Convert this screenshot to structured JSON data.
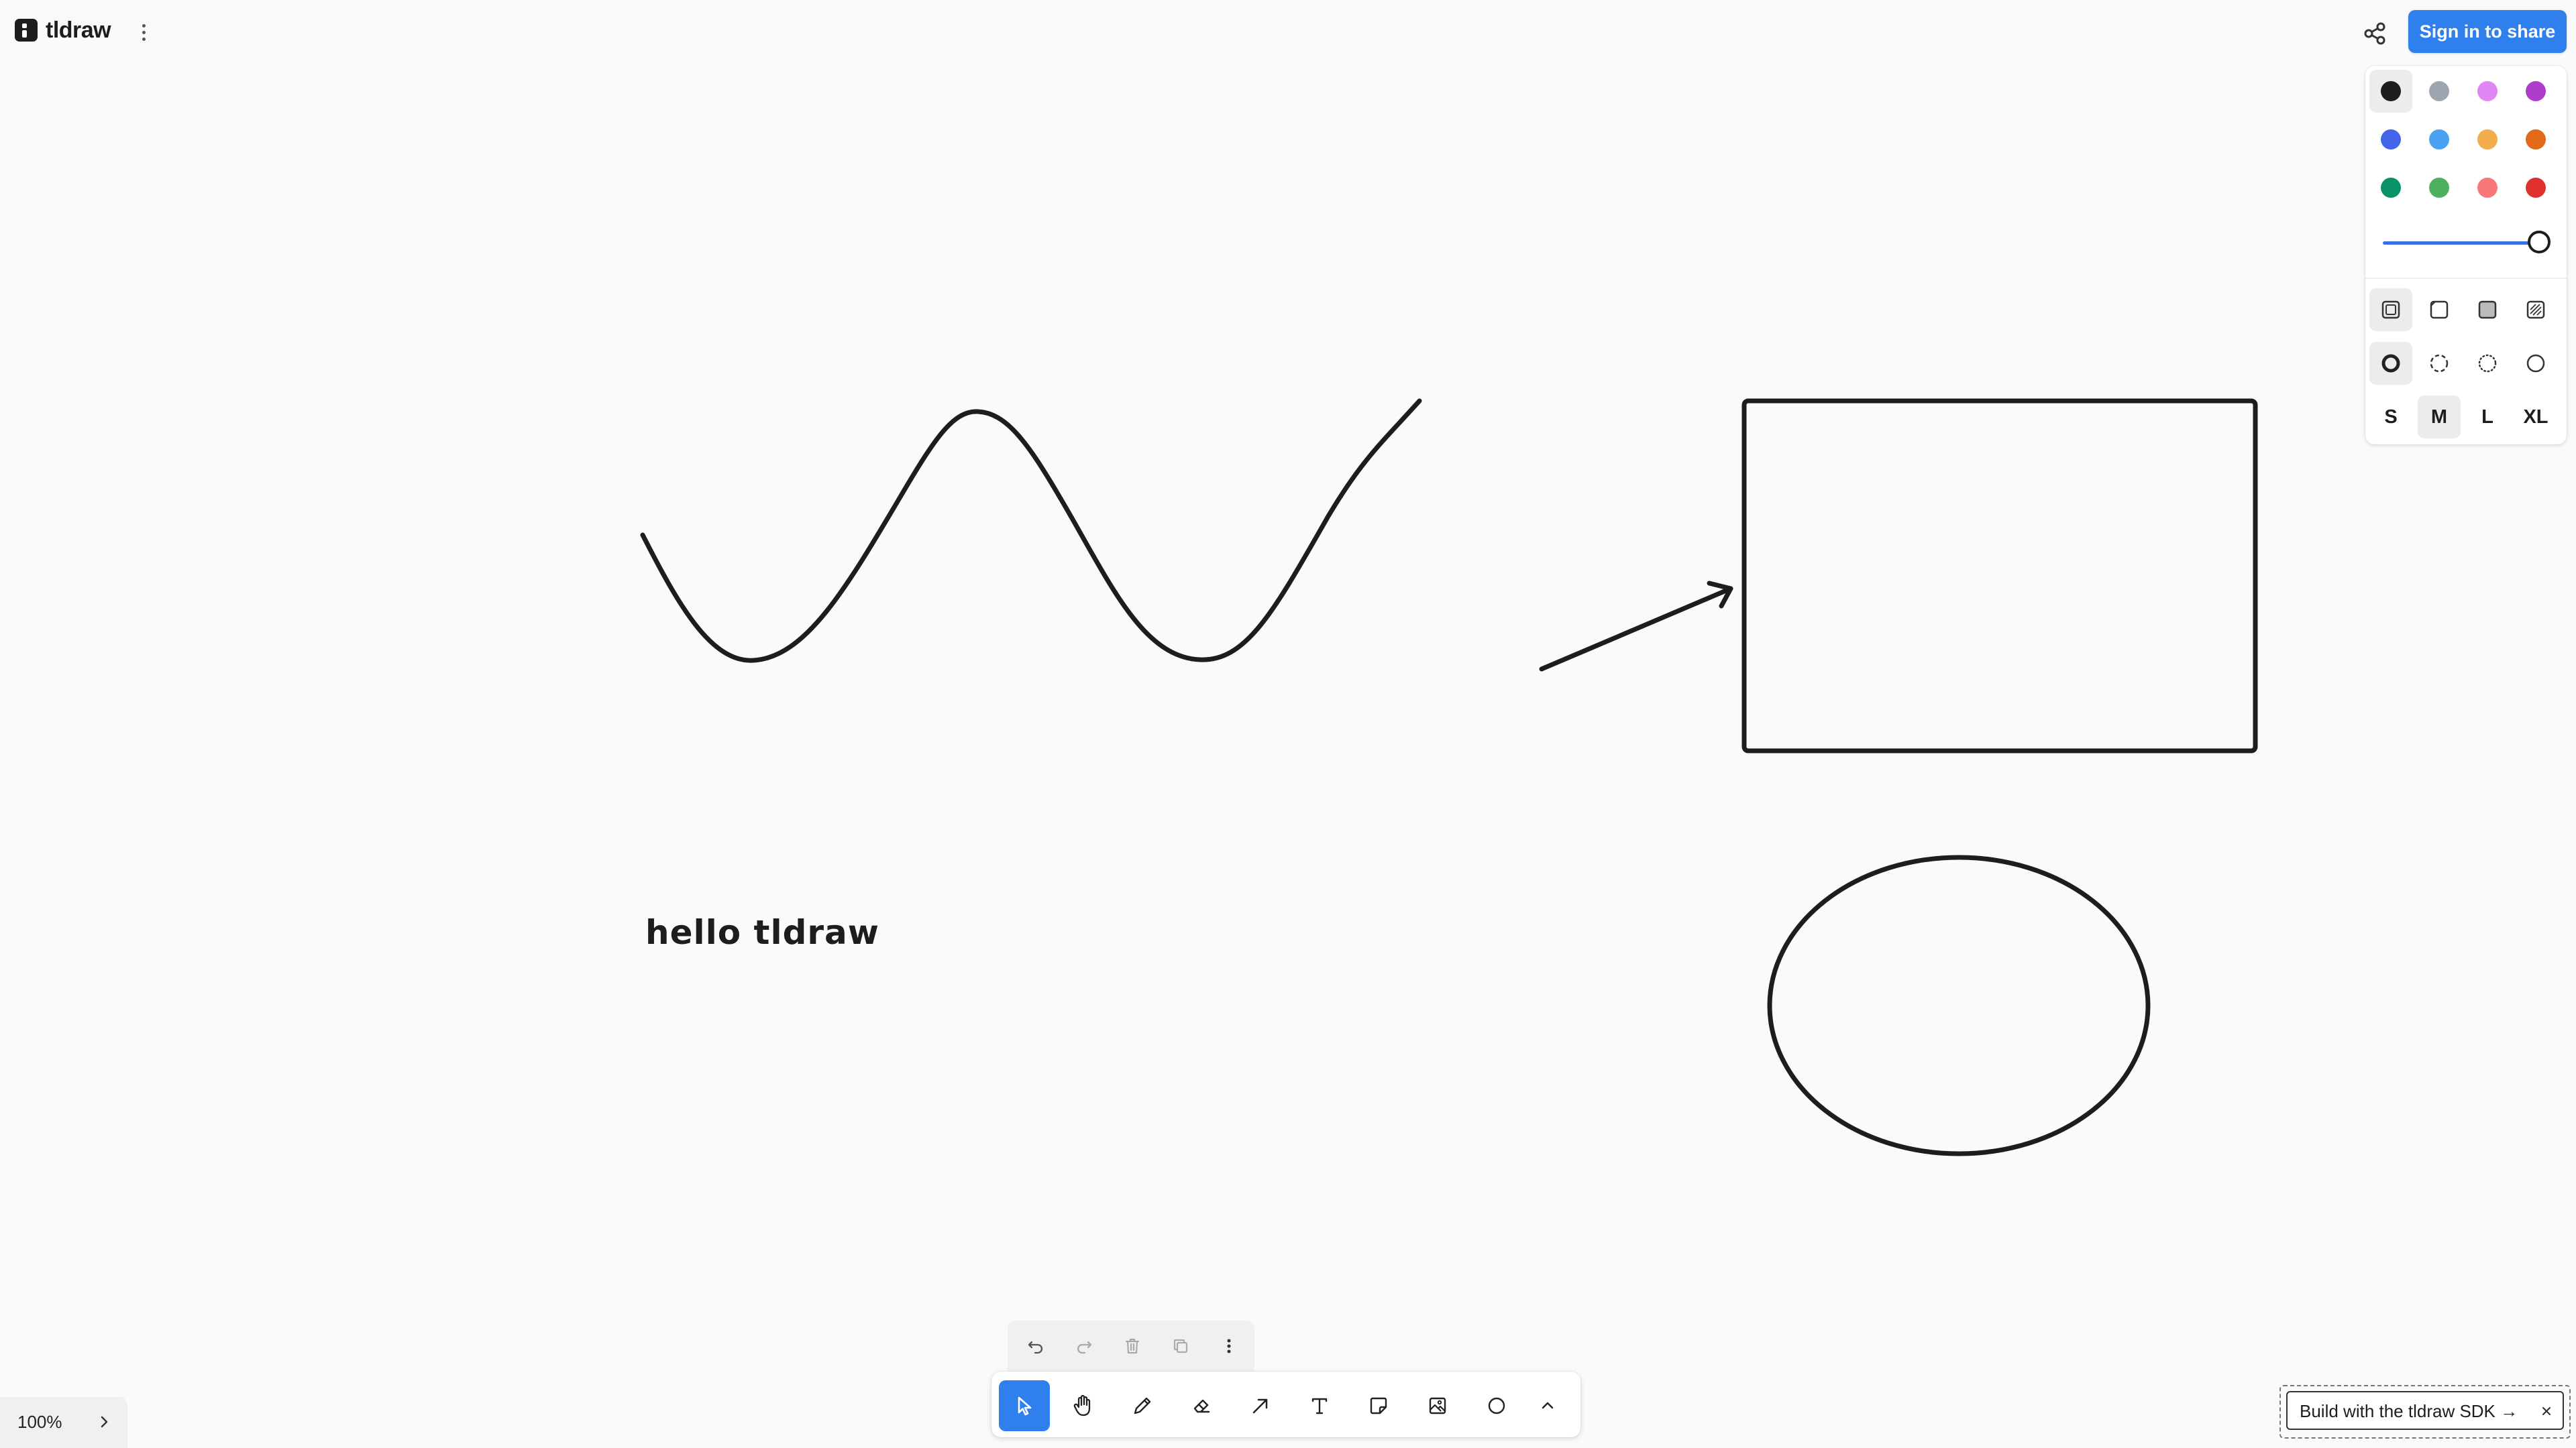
{
  "app": {
    "logo_text": "tldraw",
    "sign_in_label": "Sign in to share"
  },
  "canvas": {
    "text_shape": "hello tldraw",
    "stroke_color": "#1d1d1d",
    "background": "#f9fafb"
  },
  "style_panel": {
    "colors": [
      {
        "name": "black",
        "hex": "#1d1d1d",
        "selected": true
      },
      {
        "name": "grey",
        "hex": "#9ea5ae"
      },
      {
        "name": "light-violet",
        "hex": "#e085f4"
      },
      {
        "name": "violet",
        "hex": "#ae3ec9"
      },
      {
        "name": "blue",
        "hex": "#4465e9"
      },
      {
        "name": "light-blue",
        "hex": "#4ba1f1"
      },
      {
        "name": "yellow",
        "hex": "#f1ac4b"
      },
      {
        "name": "orange",
        "hex": "#e16919"
      },
      {
        "name": "green",
        "hex": "#099268"
      },
      {
        "name": "light-green",
        "hex": "#4cb05e"
      },
      {
        "name": "light-red",
        "hex": "#f87777"
      },
      {
        "name": "red",
        "hex": "#e03131"
      }
    ],
    "opacity": 1.0,
    "fill_options": [
      "fill-none-icon",
      "fill-semi-icon",
      "fill-solid-icon",
      "fill-pattern-icon"
    ],
    "dash_options": [
      "dash-draw-icon",
      "dash-dashed-icon",
      "dash-dotted-icon",
      "dash-solid-icon"
    ],
    "sizes": [
      "S",
      "M",
      "L",
      "XL"
    ],
    "selected_size": "M"
  },
  "zoom": {
    "label": "100%"
  },
  "action_bar": [
    "undo-icon",
    "redo-icon",
    "trash-icon",
    "duplicate-icon",
    "more-icon"
  ],
  "toolbar": [
    "select",
    "hand",
    "draw",
    "eraser",
    "arrow",
    "text",
    "note",
    "asset",
    "ellipse",
    "more"
  ],
  "sdk_banner": {
    "text": "Build with the tldraw SDK →"
  }
}
